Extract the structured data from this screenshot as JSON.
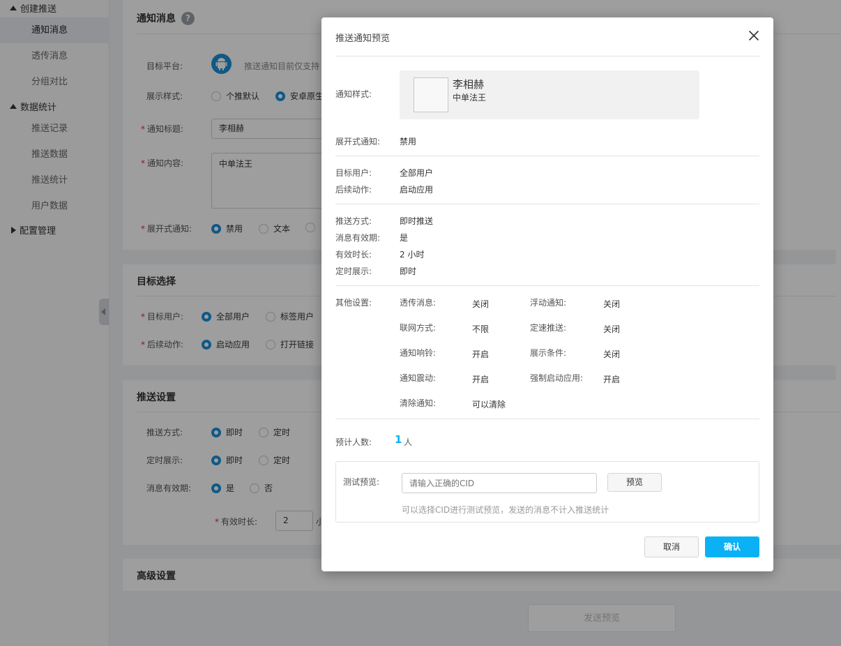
{
  "sidebar": {
    "group_create": "创建推送",
    "item_notice": "通知消息",
    "item_transparent": "透传消息",
    "item_ab": "分组对比",
    "group_stats": "数据统计",
    "item_records": "推送记录",
    "item_push_data": "推送数据",
    "item_push_stats": "推送统计",
    "item_user_data": "用户数据",
    "group_config": "配置管理"
  },
  "notice_card": {
    "title": "通知消息",
    "help_icon": "question-icon",
    "platform_label": "目标平台:",
    "platform_hint": "推送通知目前仅支持",
    "style_label": "展示样式:",
    "style_opt1": "个推默认",
    "style_opt2": "安卓原生",
    "title_label": "通知标题:",
    "title_value": "李相赫",
    "content_label": "通知内容:",
    "content_value": "中单法王",
    "expand_label": "展开式通知:",
    "expand_opt1": "禁用",
    "expand_opt2": "文本"
  },
  "target_card": {
    "title": "目标选择",
    "user_label": "目标用户:",
    "user_opt1": "全部用户",
    "user_opt2": "标签用户",
    "action_label": "后续动作:",
    "action_opt1": "启动应用",
    "action_opt2": "打开链接"
  },
  "push_card": {
    "title": "推送设置",
    "mode_label": "推送方式:",
    "mode_opt1": "即时",
    "mode_opt2": "定时",
    "timing_label": "定时展示:",
    "timing_opt1": "即时",
    "timing_opt2": "定时",
    "valid_label": "消息有效期:",
    "valid_opt1": "是",
    "valid_opt2": "否",
    "duration_label": "有效时长:",
    "duration_value": "2",
    "duration_unit": "小"
  },
  "advanced_card": {
    "title": "高级设置",
    "send_preview": "发送预览"
  },
  "modal": {
    "title": "推送通知预览",
    "style_label": "通知样式:",
    "preview_title": "李相赫",
    "preview_content": "中单法王",
    "expand_label": "展开式通知:",
    "expand_value": "禁用",
    "user_label": "目标用户:",
    "user_value": "全部用户",
    "action_label": "后续动作:",
    "action_value": "启动应用",
    "mode_label": "推送方式:",
    "mode_value": "即时推送",
    "valid_label": "消息有效期:",
    "valid_value": "是",
    "duration_label": "有效时长:",
    "duration_value": "2 小时",
    "timing_label": "定时展示:",
    "timing_value": "即时",
    "other_label": "其他设置:",
    "settings": {
      "transparent_label": "透传消息:",
      "transparent_value": "关闭",
      "float_label": "浮动通知:",
      "float_value": "关闭",
      "network_label": "联网方式:",
      "network_value": "不限",
      "rate_label": "定速推送:",
      "rate_value": "关闭",
      "ring_label": "通知响铃:",
      "ring_value": "开启",
      "condition_label": "展示条件:",
      "condition_value": "关闭",
      "vibrate_label": "通知震动:",
      "vibrate_value": "开启",
      "force_label": "强制启动应用:",
      "force_value": "开启",
      "clear_label": "清除通知:",
      "clear_value": "可以清除"
    },
    "estimate_label": "预计人数:",
    "estimate_value": "1",
    "estimate_unit": "人",
    "test_label": "测试预览:",
    "test_placeholder": "请输入正确的CID",
    "test_button": "预览",
    "test_hint": "可以选择CID进行测试预览，发送的消息不计入推送统计",
    "cancel": "取消",
    "confirm": "确认"
  },
  "colors": {
    "accent": "#1b90d8",
    "confirm_bg": "#0ab1f5",
    "estimate": "#0ab1f5"
  }
}
